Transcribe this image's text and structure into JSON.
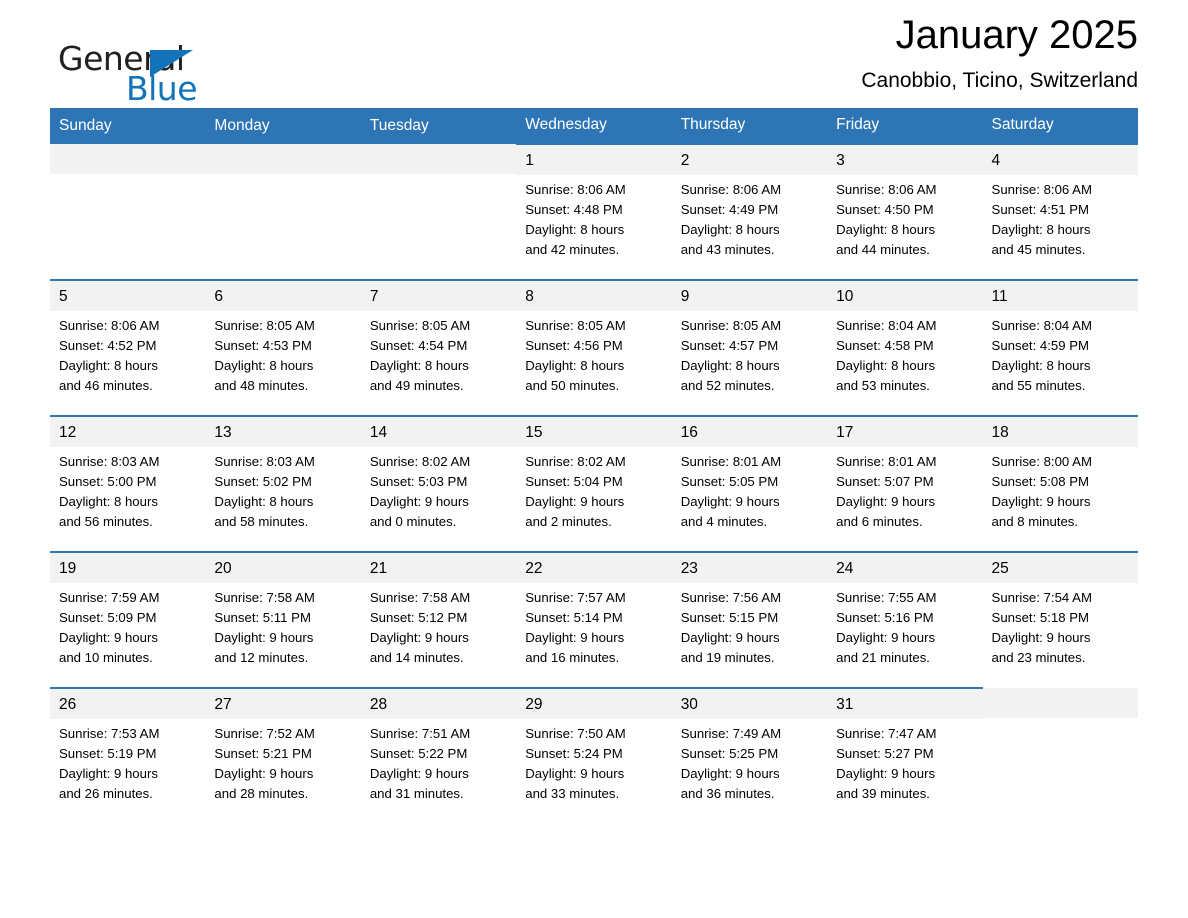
{
  "brand": {
    "line1": "General",
    "line2": "Blue",
    "triangle_color": "#1273ba"
  },
  "header": {
    "title": "January 2025",
    "subtitle": "Canobbio, Ticino, Switzerland"
  },
  "theme": {
    "header_blue": "#2e75b6",
    "daynum_band": "#f2f2f2",
    "text": "#000000"
  },
  "weekday_headers": [
    "Sunday",
    "Monday",
    "Tuesday",
    "Wednesday",
    "Thursday",
    "Friday",
    "Saturday"
  ],
  "weeks": [
    [
      {
        "day": "",
        "lines": [
          "",
          "",
          "",
          ""
        ],
        "empty": true
      },
      {
        "day": "",
        "lines": [
          "",
          "",
          "",
          ""
        ],
        "empty": true
      },
      {
        "day": "",
        "lines": [
          "",
          "",
          "",
          ""
        ],
        "empty": true
      },
      {
        "day": "1",
        "lines": [
          "Sunrise: 8:06 AM",
          "Sunset: 4:48 PM",
          "Daylight: 8 hours",
          "and 42 minutes."
        ],
        "empty": false
      },
      {
        "day": "2",
        "lines": [
          "Sunrise: 8:06 AM",
          "Sunset: 4:49 PM",
          "Daylight: 8 hours",
          "and 43 minutes."
        ],
        "empty": false
      },
      {
        "day": "3",
        "lines": [
          "Sunrise: 8:06 AM",
          "Sunset: 4:50 PM",
          "Daylight: 8 hours",
          "and 44 minutes."
        ],
        "empty": false
      },
      {
        "day": "4",
        "lines": [
          "Sunrise: 8:06 AM",
          "Sunset: 4:51 PM",
          "Daylight: 8 hours",
          "and 45 minutes."
        ],
        "empty": false
      }
    ],
    [
      {
        "day": "5",
        "lines": [
          "Sunrise: 8:06 AM",
          "Sunset: 4:52 PM",
          "Daylight: 8 hours",
          "and 46 minutes."
        ],
        "empty": false
      },
      {
        "day": "6",
        "lines": [
          "Sunrise: 8:05 AM",
          "Sunset: 4:53 PM",
          "Daylight: 8 hours",
          "and 48 minutes."
        ],
        "empty": false
      },
      {
        "day": "7",
        "lines": [
          "Sunrise: 8:05 AM",
          "Sunset: 4:54 PM",
          "Daylight: 8 hours",
          "and 49 minutes."
        ],
        "empty": false
      },
      {
        "day": "8",
        "lines": [
          "Sunrise: 8:05 AM",
          "Sunset: 4:56 PM",
          "Daylight: 8 hours",
          "and 50 minutes."
        ],
        "empty": false
      },
      {
        "day": "9",
        "lines": [
          "Sunrise: 8:05 AM",
          "Sunset: 4:57 PM",
          "Daylight: 8 hours",
          "and 52 minutes."
        ],
        "empty": false
      },
      {
        "day": "10",
        "lines": [
          "Sunrise: 8:04 AM",
          "Sunset: 4:58 PM",
          "Daylight: 8 hours",
          "and 53 minutes."
        ],
        "empty": false
      },
      {
        "day": "11",
        "lines": [
          "Sunrise: 8:04 AM",
          "Sunset: 4:59 PM",
          "Daylight: 8 hours",
          "and 55 minutes."
        ],
        "empty": false
      }
    ],
    [
      {
        "day": "12",
        "lines": [
          "Sunrise: 8:03 AM",
          "Sunset: 5:00 PM",
          "Daylight: 8 hours",
          "and 56 minutes."
        ],
        "empty": false
      },
      {
        "day": "13",
        "lines": [
          "Sunrise: 8:03 AM",
          "Sunset: 5:02 PM",
          "Daylight: 8 hours",
          "and 58 minutes."
        ],
        "empty": false
      },
      {
        "day": "14",
        "lines": [
          "Sunrise: 8:02 AM",
          "Sunset: 5:03 PM",
          "Daylight: 9 hours",
          "and 0 minutes."
        ],
        "empty": false
      },
      {
        "day": "15",
        "lines": [
          "Sunrise: 8:02 AM",
          "Sunset: 5:04 PM",
          "Daylight: 9 hours",
          "and 2 minutes."
        ],
        "empty": false
      },
      {
        "day": "16",
        "lines": [
          "Sunrise: 8:01 AM",
          "Sunset: 5:05 PM",
          "Daylight: 9 hours",
          "and 4 minutes."
        ],
        "empty": false
      },
      {
        "day": "17",
        "lines": [
          "Sunrise: 8:01 AM",
          "Sunset: 5:07 PM",
          "Daylight: 9 hours",
          "and 6 minutes."
        ],
        "empty": false
      },
      {
        "day": "18",
        "lines": [
          "Sunrise: 8:00 AM",
          "Sunset: 5:08 PM",
          "Daylight: 9 hours",
          "and 8 minutes."
        ],
        "empty": false
      }
    ],
    [
      {
        "day": "19",
        "lines": [
          "Sunrise: 7:59 AM",
          "Sunset: 5:09 PM",
          "Daylight: 9 hours",
          "and 10 minutes."
        ],
        "empty": false
      },
      {
        "day": "20",
        "lines": [
          "Sunrise: 7:58 AM",
          "Sunset: 5:11 PM",
          "Daylight: 9 hours",
          "and 12 minutes."
        ],
        "empty": false
      },
      {
        "day": "21",
        "lines": [
          "Sunrise: 7:58 AM",
          "Sunset: 5:12 PM",
          "Daylight: 9 hours",
          "and 14 minutes."
        ],
        "empty": false
      },
      {
        "day": "22",
        "lines": [
          "Sunrise: 7:57 AM",
          "Sunset: 5:14 PM",
          "Daylight: 9 hours",
          "and 16 minutes."
        ],
        "empty": false
      },
      {
        "day": "23",
        "lines": [
          "Sunrise: 7:56 AM",
          "Sunset: 5:15 PM",
          "Daylight: 9 hours",
          "and 19 minutes."
        ],
        "empty": false
      },
      {
        "day": "24",
        "lines": [
          "Sunrise: 7:55 AM",
          "Sunset: 5:16 PM",
          "Daylight: 9 hours",
          "and 21 minutes."
        ],
        "empty": false
      },
      {
        "day": "25",
        "lines": [
          "Sunrise: 7:54 AM",
          "Sunset: 5:18 PM",
          "Daylight: 9 hours",
          "and 23 minutes."
        ],
        "empty": false
      }
    ],
    [
      {
        "day": "26",
        "lines": [
          "Sunrise: 7:53 AM",
          "Sunset: 5:19 PM",
          "Daylight: 9 hours",
          "and 26 minutes."
        ],
        "empty": false
      },
      {
        "day": "27",
        "lines": [
          "Sunrise: 7:52 AM",
          "Sunset: 5:21 PM",
          "Daylight: 9 hours",
          "and 28 minutes."
        ],
        "empty": false
      },
      {
        "day": "28",
        "lines": [
          "Sunrise: 7:51 AM",
          "Sunset: 5:22 PM",
          "Daylight: 9 hours",
          "and 31 minutes."
        ],
        "empty": false
      },
      {
        "day": "29",
        "lines": [
          "Sunrise: 7:50 AM",
          "Sunset: 5:24 PM",
          "Daylight: 9 hours",
          "and 33 minutes."
        ],
        "empty": false
      },
      {
        "day": "30",
        "lines": [
          "Sunrise: 7:49 AM",
          "Sunset: 5:25 PM",
          "Daylight: 9 hours",
          "and 36 minutes."
        ],
        "empty": false
      },
      {
        "day": "31",
        "lines": [
          "Sunrise: 7:47 AM",
          "Sunset: 5:27 PM",
          "Daylight: 9 hours",
          "and 39 minutes."
        ],
        "empty": false
      },
      {
        "day": "",
        "lines": [
          "",
          "",
          "",
          ""
        ],
        "empty": true
      }
    ]
  ]
}
